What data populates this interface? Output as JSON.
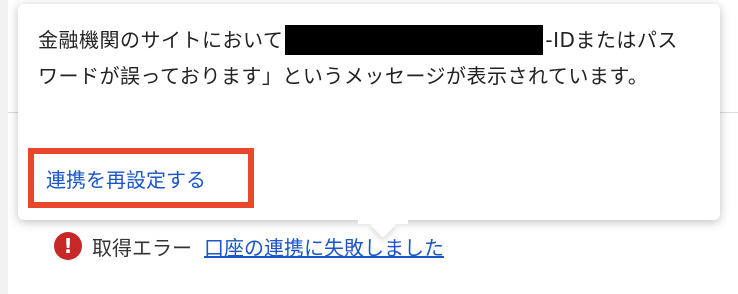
{
  "popover": {
    "message_part1": "金融機関のサイトにおいて",
    "message_part2": "-IDまたはパスワードが誤っております」というメッセージが表示されています。",
    "relink_button": "連携を再設定する"
  },
  "status": {
    "error_label": "取得エラー",
    "error_link": "口座の連携に失敗しました",
    "error_icon": "!"
  },
  "colors": {
    "link": "#1a56c8",
    "highlight_border": "#e8462d",
    "error_icon_bg": "#c62828"
  }
}
